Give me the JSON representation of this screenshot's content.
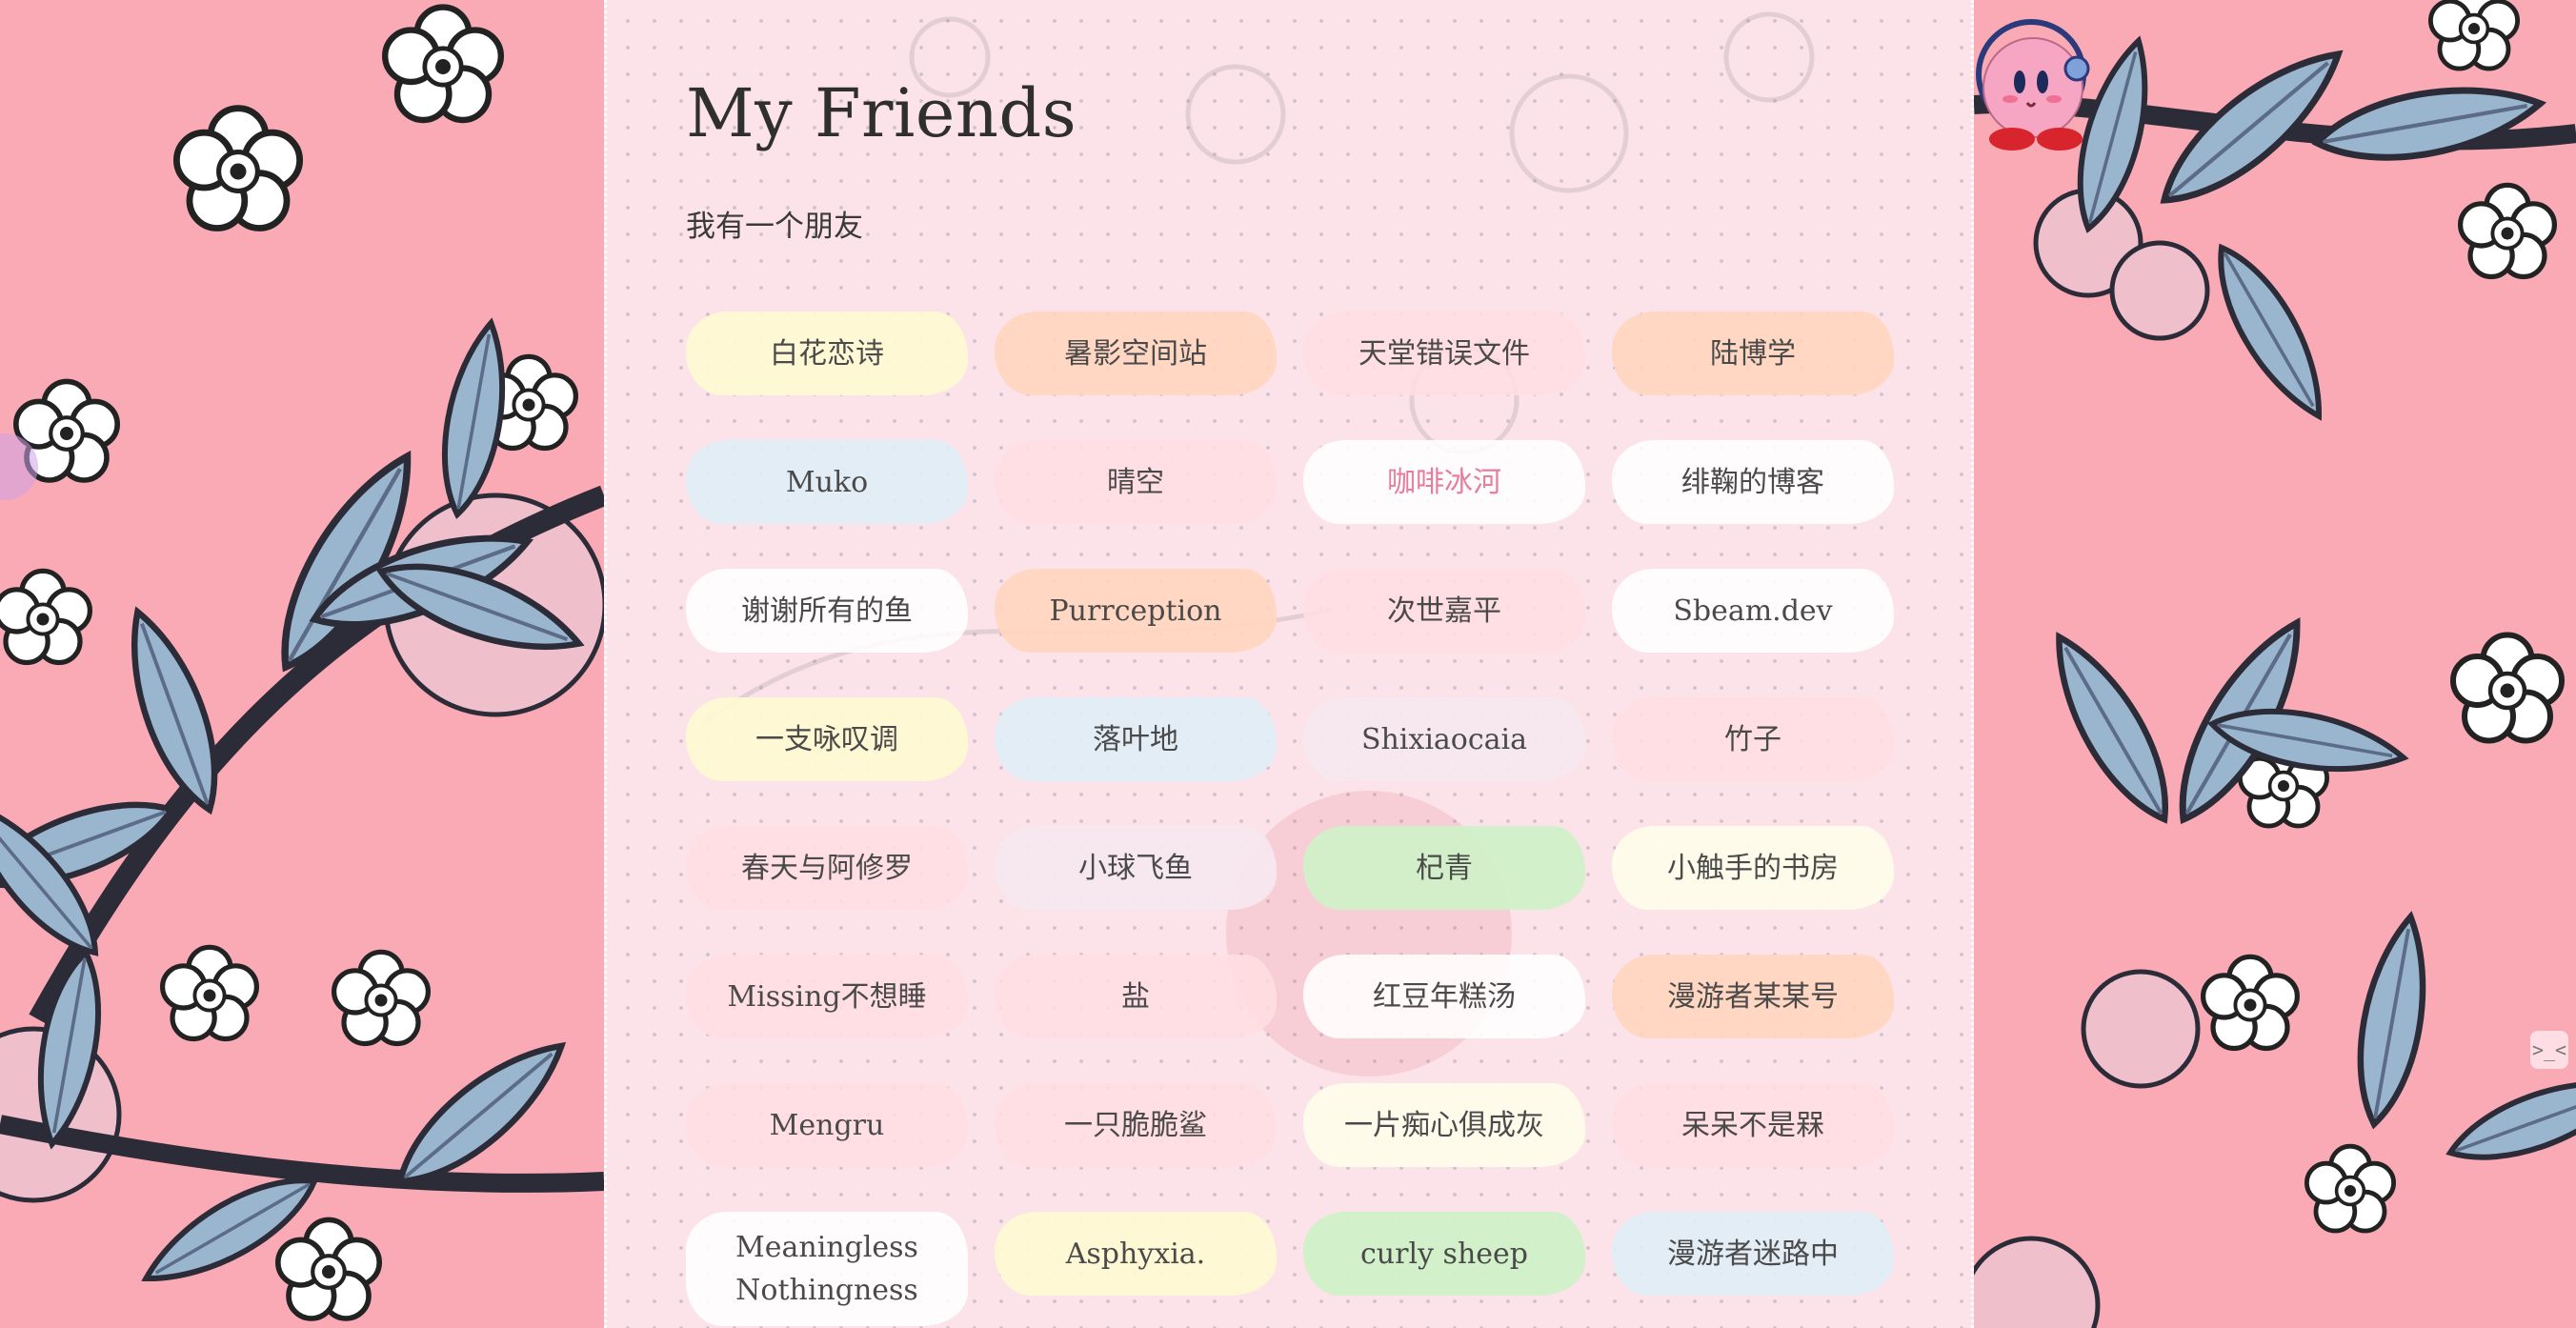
{
  "page": {
    "title": "My Friends",
    "subtitle": "我有一个朋友"
  },
  "friends": [
    {
      "name": "白花恋诗"
    },
    {
      "name": "暑影空间站"
    },
    {
      "name": "天堂错误文件"
    },
    {
      "name": "陆博学"
    },
    {
      "name": "Muko"
    },
    {
      "name": "晴空"
    },
    {
      "name": "咖啡冰河"
    },
    {
      "name": "绯鞠的博客"
    },
    {
      "name": "谢谢所有的鱼"
    },
    {
      "name": "Purrception"
    },
    {
      "name": "次世嘉平"
    },
    {
      "name": "Sbeam.dev"
    },
    {
      "name": "一支咏叹调"
    },
    {
      "name": "落叶地"
    },
    {
      "name": "Shixiaocaia"
    },
    {
      "name": "竹子"
    },
    {
      "name": "春天与阿修罗"
    },
    {
      "name": "小球飞鱼"
    },
    {
      "name": "杞青"
    },
    {
      "name": "小触手的书房"
    },
    {
      "name": "Missing不想睡"
    },
    {
      "name": "盐"
    },
    {
      "name": "红豆年糕汤"
    },
    {
      "name": "漫游者某某号"
    },
    {
      "name": "Mengru"
    },
    {
      "name": "一只脆脆鲨"
    },
    {
      "name": "一片痴心俱成灰"
    },
    {
      "name": "呆呆不是槑"
    },
    {
      "name": "Meaningless Nothingness"
    },
    {
      "name": "Asphyxia."
    },
    {
      "name": "curly sheep"
    },
    {
      "name": "漫游者迷路中"
    }
  ],
  "widgets": {
    "side_handle_label": ">_<",
    "hover_link_color": "#e77d9c",
    "background_pink": "#f9aab5",
    "leaf_blue": "#9ab6cf"
  }
}
